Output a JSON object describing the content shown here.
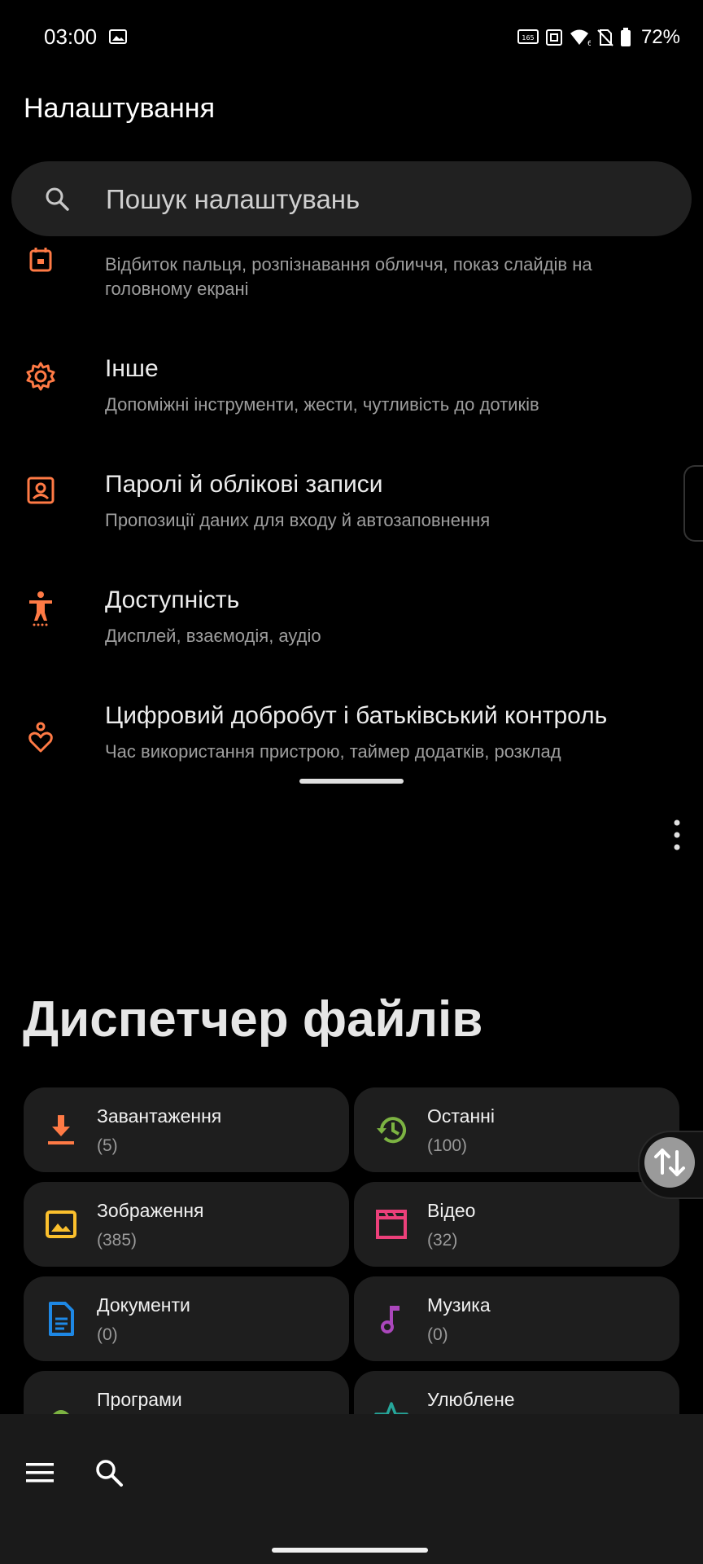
{
  "status": {
    "time": "03:00",
    "battery": "72%"
  },
  "settings": {
    "title": "Налаштування",
    "search_placeholder": "Пошук налаштувань",
    "items": [
      {
        "title": "",
        "subtitle": "Відбиток пальця, розпізнавання обличчя, показ слайдів на головному екрані",
        "icon": "calendar-lock-icon"
      },
      {
        "title": "Інше",
        "subtitle": "Допоміжні інструменти, жести, чутливість до дотиків",
        "icon": "gear-icon"
      },
      {
        "title": "Паролі й облікові записи",
        "subtitle": "Пропозиції даних для входу й автозаповнення",
        "icon": "account-box-icon"
      },
      {
        "title": "Доступність",
        "subtitle": "Дисплей, взаємодія, аудіо",
        "icon": "accessibility-icon"
      },
      {
        "title": "Цифровий добробут і батьківський контроль",
        "subtitle": "Час використання пристрою, таймер додатків, розклад",
        "icon": "heart-person-icon"
      }
    ],
    "accent": "#ff7a45"
  },
  "files": {
    "title": "Диспетчер файлів",
    "cards": [
      {
        "name": "Завантаження",
        "count": "(5)",
        "icon": "download-icon",
        "color": "#ff7a45"
      },
      {
        "name": "Останні",
        "count": "(100)",
        "icon": "history-icon",
        "color": "#7cb342"
      },
      {
        "name": "Зображення",
        "count": "(385)",
        "icon": "image-icon",
        "color": "#fbc02d"
      },
      {
        "name": "Відео",
        "count": "(32)",
        "icon": "video-icon",
        "color": "#ec407a"
      },
      {
        "name": "Документи",
        "count": "(0)",
        "icon": "document-icon",
        "color": "#1e88e5"
      },
      {
        "name": "Музика",
        "count": "(0)",
        "icon": "music-icon",
        "color": "#ab47bc"
      },
      {
        "name": "Програми",
        "count": "",
        "icon": "android-icon",
        "color": "#7cb342"
      },
      {
        "name": "Улюблене",
        "count": "",
        "icon": "star-icon",
        "color": "#26a69a"
      }
    ]
  }
}
